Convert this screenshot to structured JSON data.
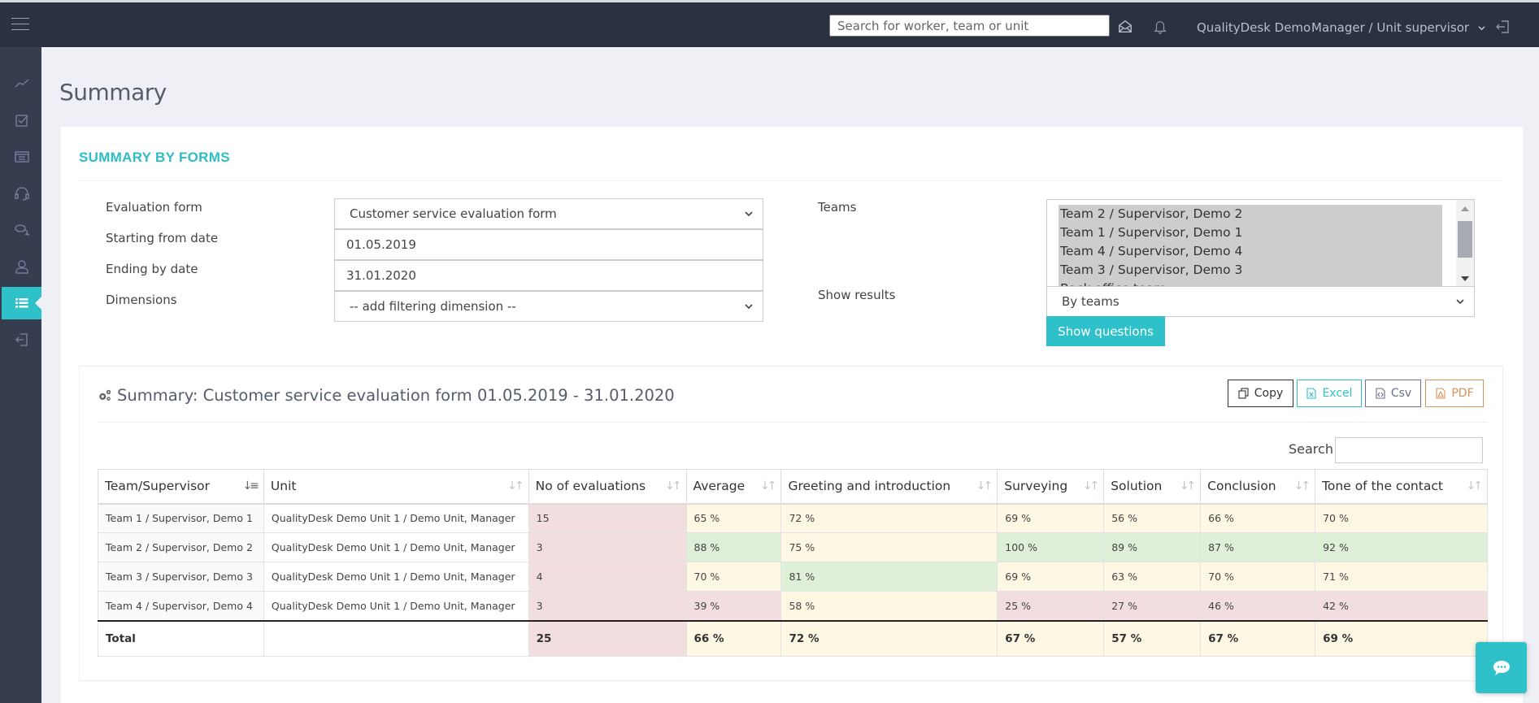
{
  "header": {
    "search_placeholder": "Search for worker, team or unit",
    "company": "QualityDesk Demo",
    "role": "Manager / Unit supervisor",
    "icons": [
      "menu-icon",
      "envelope-open-icon",
      "bell-icon",
      "chevron-down-icon",
      "sign-out-icon"
    ]
  },
  "sidebar": {
    "items": [
      {
        "name": "dashboard",
        "icon": "line-chart-icon",
        "active": false
      },
      {
        "name": "evaluations",
        "icon": "checkbox-icon",
        "active": false
      },
      {
        "name": "reports-list",
        "icon": "list-box-icon",
        "active": false
      },
      {
        "name": "calls",
        "icon": "headset-icon",
        "active": false
      },
      {
        "name": "conversations",
        "icon": "chat-bubbles-icon",
        "active": false
      },
      {
        "name": "users",
        "icon": "user-icon",
        "active": false
      },
      {
        "name": "summary",
        "icon": "list-icon",
        "active": true
      },
      {
        "name": "logout",
        "icon": "sign-out-icon",
        "active": false
      }
    ]
  },
  "page": {
    "title": "Summary",
    "panel_title": "SUMMARY BY FORMS"
  },
  "filters": {
    "evaluation_form_label": "Evaluation form",
    "evaluation_form_value": "Customer service evaluation form",
    "start_date_label": "Starting from date",
    "start_date_value": "01.05.2019",
    "end_date_label": "Ending by date",
    "end_date_value": "31.01.2020",
    "dimensions_label": "Dimensions",
    "dimensions_value": "-- add filtering dimension --",
    "teams_label": "Teams",
    "teams_options": [
      "Team 2 / Supervisor, Demo 2",
      "Team 1 / Supervisor, Demo 1",
      "Team 4 / Supervisor, Demo 4",
      "Team 3 / Supervisor, Demo 3",
      "Back office team..."
    ],
    "show_results_label": "Show results",
    "show_results_value": "By teams",
    "show_questions_button": "Show questions"
  },
  "results": {
    "title": "Summary: Customer service evaluation form 01.05.2019 - 31.01.2020",
    "export_buttons": [
      {
        "label": "Copy",
        "color": "#333333"
      },
      {
        "label": "Excel",
        "color": "#2ec1c9"
      },
      {
        "label": "Csv",
        "color": "#6b6f8a"
      },
      {
        "label": "PDF",
        "color": "#d6925a"
      }
    ],
    "search_label": "Search",
    "search_value": "",
    "columns": [
      "Team/Supervisor",
      "Unit",
      "No of evaluations",
      "Average",
      "Greeting and introduction",
      "Surveying",
      "Solution",
      "Conclusion",
      "Tone of the contact"
    ],
    "rows": [
      {
        "cells": [
          "Team 1 / Supervisor, Demo 1",
          "QualityDesk Demo Unit 1 / Demo Unit, Manager",
          "15",
          "65 %",
          "72 %",
          "69 %",
          "56 %",
          "66 %",
          "70 %"
        ],
        "status": [
          "first",
          "plain",
          "bad",
          "mid",
          "mid",
          "mid",
          "mid",
          "mid",
          "mid"
        ]
      },
      {
        "cells": [
          "Team 2 / Supervisor, Demo 2",
          "QualityDesk Demo Unit 1 / Demo Unit, Manager",
          "3",
          "88 %",
          "75 %",
          "100 %",
          "89 %",
          "87 %",
          "92 %"
        ],
        "status": [
          "first",
          "plain",
          "bad",
          "good",
          "mid",
          "good",
          "good",
          "good",
          "good"
        ]
      },
      {
        "cells": [
          "Team 3 / Supervisor, Demo 3",
          "QualityDesk Demo Unit 1 / Demo Unit, Manager",
          "4",
          "70 %",
          "81 %",
          "69 %",
          "63 %",
          "70 %",
          "71 %"
        ],
        "status": [
          "first",
          "plain",
          "bad",
          "mid",
          "good",
          "mid",
          "mid",
          "mid",
          "mid"
        ]
      },
      {
        "cells": [
          "Team 4 / Supervisor, Demo 4",
          "QualityDesk Demo Unit 1 / Demo Unit, Manager",
          "3",
          "39 %",
          "58 %",
          "25 %",
          "27 %",
          "46 %",
          "42 %"
        ],
        "status": [
          "first",
          "plain",
          "bad",
          "bad",
          "mid",
          "bad",
          "bad",
          "bad",
          "bad"
        ]
      }
    ],
    "total": {
      "cells": [
        "Total",
        "",
        "25",
        "66 %",
        "72 %",
        "67 %",
        "57 %",
        "67 %",
        "69 %"
      ],
      "status": [
        "plain",
        "plain",
        "bad",
        "mid",
        "mid",
        "mid",
        "mid",
        "mid",
        "mid"
      ]
    }
  },
  "colors": {
    "accent": "#2ec1c9",
    "topbar": "#2a3241",
    "sidebar": "#363d4f",
    "bad": "#f2dede",
    "mid": "#fcf8e3",
    "good": "#dff0d8"
  }
}
